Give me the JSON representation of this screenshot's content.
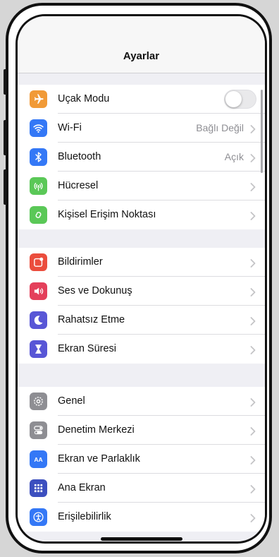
{
  "navbar": {
    "title": "Ayarlar"
  },
  "groups": [
    [
      {
        "label": "Uçak Modu",
        "icon": "airplane-icon",
        "color": "#f19a37",
        "control": "toggle",
        "toggle_on": false
      },
      {
        "label": "Wi-Fi",
        "value": "Bağlı Değil",
        "icon": "wifi-icon",
        "color": "#3478f6"
      },
      {
        "label": "Bluetooth",
        "value": "Açık",
        "icon": "bluetooth-icon",
        "color": "#3478f6"
      },
      {
        "label": "Hücresel",
        "icon": "cellular-icon",
        "color": "#5ac857"
      },
      {
        "label": "Kişisel Erişim Noktası",
        "icon": "hotspot-icon",
        "color": "#5ac857"
      }
    ],
    [
      {
        "label": "Bildirimler",
        "icon": "notifications-icon",
        "color": "#eb4d3d"
      },
      {
        "label": "Ses ve Dokunuş",
        "icon": "sound-icon",
        "color": "#e43f5a"
      },
      {
        "label": "Rahatsız Etme",
        "icon": "moon-icon",
        "color": "#5856d6"
      },
      {
        "label": "Ekran Süresi",
        "icon": "hourglass-icon",
        "color": "#5856d6"
      }
    ],
    [
      {
        "label": "Genel",
        "icon": "gear-icon",
        "color": "#8e8e93"
      },
      {
        "label": "Denetim Merkezi",
        "icon": "control-center-icon",
        "color": "#8e8e93"
      },
      {
        "label": "Ekran ve Parlaklık",
        "icon": "text-size-icon",
        "color": "#3478f6"
      },
      {
        "label": "Ana Ekran",
        "icon": "home-screen-icon",
        "color": "#3c4fbf"
      },
      {
        "label": "Erişilebilirlik",
        "icon": "accessibility-icon",
        "color": "#3478f6"
      }
    ]
  ]
}
